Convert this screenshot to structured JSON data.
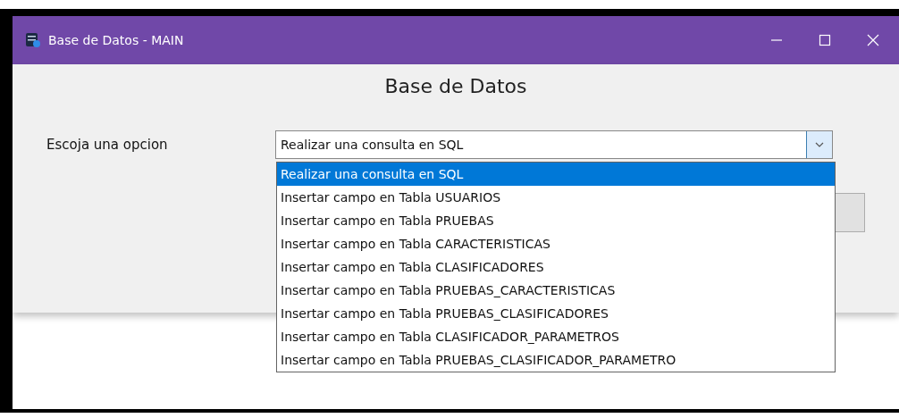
{
  "window": {
    "title": "Base de Datos - MAIN"
  },
  "heading": "Base de Datos",
  "field_label": "Escoja una opcion",
  "combo": {
    "value": "Realizar una consulta en SQL",
    "expanded": true
  },
  "options": [
    {
      "label": "Realizar una consulta en SQL",
      "selected": true
    },
    {
      "label": "Insertar campo en Tabla USUARIOS",
      "selected": false
    },
    {
      "label": "Insertar campo en Tabla PRUEBAS",
      "selected": false
    },
    {
      "label": "Insertar campo en Tabla CARACTERISTICAS",
      "selected": false
    },
    {
      "label": "Insertar campo en Tabla CLASIFICADORES",
      "selected": false
    },
    {
      "label": "Insertar campo en Tabla PRUEBAS_CARACTERISTICAS",
      "selected": false
    },
    {
      "label": "Insertar campo en Tabla PRUEBAS_CLASIFICADORES",
      "selected": false
    },
    {
      "label": "Insertar campo en Tabla CLASIFICADOR_PARAMETROS",
      "selected": false
    },
    {
      "label": "Insertar campo en Tabla PRUEBAS_CLASIFICADOR_PARAMETRO",
      "selected": false
    }
  ]
}
